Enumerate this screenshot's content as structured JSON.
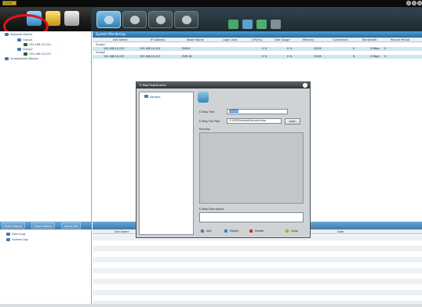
{
  "app": {
    "logo_text": "DVMRG"
  },
  "sidebar": {
    "tree": [
      {
        "label": "Regional Device"
      },
      {
        "label": "Group1"
      },
      {
        "label": "192.168.10.224"
      },
      {
        "label": "Group2"
      },
      {
        "label": "192.168.10.223"
      },
      {
        "label": "Unregistered Device"
      }
    ]
  },
  "monitor": {
    "title": "System Monitoring",
    "columns": [
      "Dev Name",
      "IP Address",
      "Model Name",
      "Login User",
      "CPU(%)",
      "Disk Usage",
      "Memory",
      "Connection",
      "Bandwidth",
      "Record Period"
    ],
    "rows": [
      {
        "type": "group",
        "name": "Group1"
      },
      {
        "type": "device",
        "cells": [
          "192.168.10.224",
          "192.168.10.224",
          "DVR-8",
          "",
          "0 %",
          "0 %",
          "32/28",
          "0",
          "0 Mbps",
          "0"
        ]
      },
      {
        "type": "group",
        "name": "Group2"
      },
      {
        "type": "device",
        "cells": [
          "192.168.10.223",
          "192.168.10.223",
          "DVR-16",
          "",
          "0 %",
          "0 %",
          "32/28",
          "0",
          "0 Mbps",
          "0"
        ]
      }
    ]
  },
  "dialog": {
    "title": "E-Map Registration",
    "list_item": "Sample",
    "map_title_label": "E-Map Title",
    "map_title_value": "Sample",
    "map_file_path_label": "E-Map File Path",
    "map_file_path_value": "C:\\DVR\\Sample\\Sample.bmp",
    "open_label": "Open",
    "preview_label": "Preview",
    "description_label": "E-Map Description",
    "buttons": {
      "add": "Add",
      "modify": "Modify",
      "delete": "Delete",
      "close": "Close"
    }
  },
  "bottom": {
    "tabs": [
      "Event Status",
      "Event Search",
      "Alarm List"
    ],
    "tree": [
      "Event Log",
      "System Log"
    ],
    "columns": [
      "Dev Name",
      "Date"
    ]
  },
  "colors": {
    "highlight_ring": "#e0131b",
    "accent": "#2a6da3"
  }
}
